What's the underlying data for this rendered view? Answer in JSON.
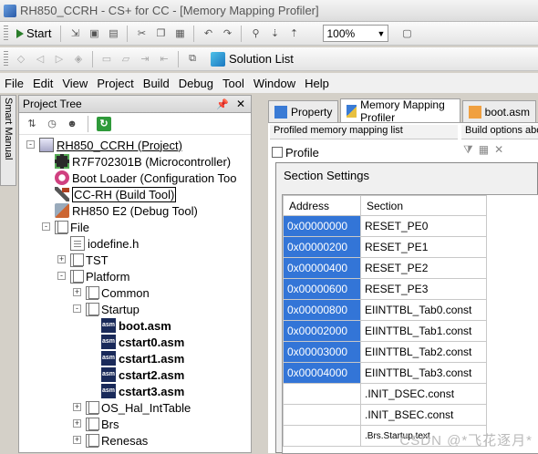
{
  "window": {
    "title": "RH850_CCRH - CS+ for CC - [Memory Mapping Profiler]"
  },
  "toolbar1": {
    "start_label": "Start",
    "zoom_value": "100%"
  },
  "toolbar2": {
    "solution_list_label": "Solution List"
  },
  "menu": [
    "File",
    "Edit",
    "View",
    "Project",
    "Build",
    "Debug",
    "Tool",
    "Window",
    "Help"
  ],
  "side_tab": {
    "label": "Smart Manual"
  },
  "project_tree": {
    "title": "Project Tree",
    "items": [
      {
        "label": "RH850_CCRH (Project)",
        "icon": "project-icon",
        "depth": 0,
        "expander": "-"
      },
      {
        "label": "R7F702301B (Microcontroller)",
        "icon": "chip-icon",
        "depth": 1,
        "expander": ""
      },
      {
        "label": "Boot Loader (Configuration Too",
        "icon": "boot-icon",
        "depth": 1,
        "expander": ""
      },
      {
        "label": "CC-RH (Build Tool)",
        "icon": "hammer-icon",
        "depth": 1,
        "expander": ""
      },
      {
        "label": "RH850 E2 (Debug Tool)",
        "icon": "debug-icon",
        "depth": 1,
        "expander": ""
      },
      {
        "label": "File",
        "icon": "folder-icon",
        "depth": 1,
        "expander": "-"
      },
      {
        "label": "iodefine.h",
        "icon": "file-icon",
        "depth": 2,
        "expander": ""
      },
      {
        "label": "TST",
        "icon": "folder-icon",
        "depth": 2,
        "expander": "+"
      },
      {
        "label": "Platform",
        "icon": "folder-icon",
        "depth": 2,
        "expander": "-"
      },
      {
        "label": "Common",
        "icon": "folder-icon",
        "depth": 3,
        "expander": "+"
      },
      {
        "label": "Startup",
        "icon": "folder-icon",
        "depth": 3,
        "expander": "-"
      },
      {
        "label": "boot.asm",
        "icon": "asm-icon",
        "depth": 4,
        "expander": ""
      },
      {
        "label": "cstart0.asm",
        "icon": "asm-icon",
        "depth": 4,
        "expander": ""
      },
      {
        "label": "cstart1.asm",
        "icon": "asm-icon",
        "depth": 4,
        "expander": ""
      },
      {
        "label": "cstart2.asm",
        "icon": "asm-icon",
        "depth": 4,
        "expander": ""
      },
      {
        "label": "cstart3.asm",
        "icon": "asm-icon",
        "depth": 4,
        "expander": ""
      },
      {
        "label": "OS_Hal_IntTable",
        "icon": "folder-icon",
        "depth": 3,
        "expander": "+"
      },
      {
        "label": "Brs",
        "icon": "folder-icon",
        "depth": 3,
        "expander": "+"
      },
      {
        "label": "Renesas",
        "icon": "folder-icon",
        "depth": 3,
        "expander": "+"
      }
    ]
  },
  "tabs": [
    {
      "label": "Property",
      "icon": "property-icon",
      "active": false
    },
    {
      "label": "Memory Mapping Profiler",
      "icon": "profiler-icon",
      "active": true
    },
    {
      "label": "boot.asm",
      "icon": "asm-tab-icon",
      "active": false
    }
  ],
  "profiler": {
    "mapping_list_label": "Profiled memory mapping list",
    "build_options_label": "Build options abo",
    "profile_button": "Profile"
  },
  "section_settings": {
    "title": "Section Settings",
    "columns": [
      "Address",
      "Section"
    ],
    "rows": [
      {
        "address": "0x00000000",
        "section": "RESET_PE0"
      },
      {
        "address": "0x00000200",
        "section": "RESET_PE1"
      },
      {
        "address": "0x00000400",
        "section": "RESET_PE2"
      },
      {
        "address": "0x00000600",
        "section": "RESET_PE3"
      },
      {
        "address": "0x00000800",
        "section": "EIINTTBL_Tab0.const"
      },
      {
        "address": "0x00002000",
        "section": "EIINTTBL_Tab1.const"
      },
      {
        "address": "0x00003000",
        "section": "EIINTTBL_Tab2.const"
      },
      {
        "address": "0x00004000",
        "section": "EIINTTBL_Tab3.const"
      },
      {
        "address": "",
        "section": ".INIT_DSEC.const"
      },
      {
        "address": "",
        "section": ".INIT_BSEC.const"
      },
      {
        "address": "",
        "section": ".Brs.Startup.text"
      }
    ]
  },
  "watermark": "CSDN @*飞花逐月*",
  "colors": {
    "selection": "#3375d7",
    "refresh": "#2f9a3a"
  }
}
